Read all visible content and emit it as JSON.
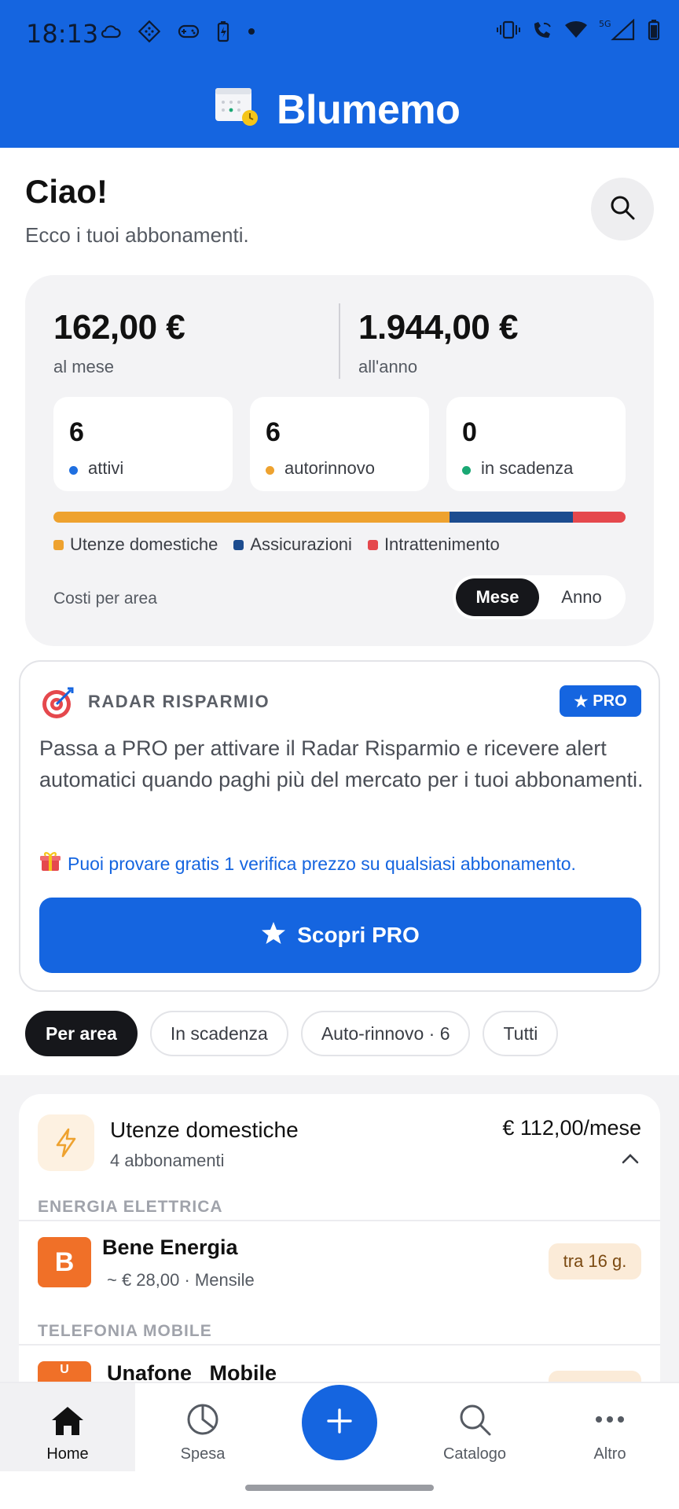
{
  "status": {
    "time": "18:13",
    "network": "5G"
  },
  "app": {
    "title": "Blumemo"
  },
  "greeting": {
    "title": "Ciao!",
    "subtitle": "Ecco i tuoi abbonamenti."
  },
  "summary": {
    "monthly_amount": "162,00 €",
    "monthly_label": "al mese",
    "yearly_amount": "1.944,00 €",
    "yearly_label": "all'anno",
    "stats": [
      {
        "value": "6",
        "label": "attivi",
        "color": "#1f6fe0"
      },
      {
        "value": "6",
        "label": "autorinnovo",
        "color": "#eea22f"
      },
      {
        "value": "0",
        "label": "in scadenza",
        "color": "#1aa874"
      }
    ],
    "breakdown": [
      {
        "label": "Utenze domestiche",
        "share": 0.692,
        "color": "#eea22f"
      },
      {
        "label": "Assicurazioni",
        "share": 0.216,
        "color": "#1c4c8f"
      },
      {
        "label": "Intrattenimento",
        "share": 0.092,
        "color": "#e5484d"
      }
    ],
    "cost_label": "Costi per area",
    "toggle": {
      "selected": "Mese",
      "other": "Anno"
    }
  },
  "radar": {
    "title": "RADAR RISPARMIO",
    "badge": "PRO",
    "description": "Passa a PRO per attivare il Radar Risparmio e ricevere alert automatici quando paghi più del mercato per i tuoi abbonamenti.",
    "gift_text": "Puoi provare gratis 1 verifica prezzo su qualsiasi abbonamento.",
    "cta": "Scopri PRO"
  },
  "filters": [
    "Per area",
    "In scadenza",
    "Auto-rinnovo · 6",
    "Tutti"
  ],
  "group": {
    "title": "Utenze domestiche",
    "count": "4 abbonamenti",
    "amount": "€ 112,00/mese",
    "sections": [
      {
        "header": "ENERGIA ELETTRICA",
        "items": [
          {
            "logo": "B",
            "name": "Bene Energia",
            "meta": "~ € 28,00 · Mensile",
            "due": "tra 16 g."
          }
        ]
      },
      {
        "header": "TELEFONIA MOBILE",
        "items": [
          {
            "logo": "U",
            "name": "Unafone   Mobile"
          }
        ]
      }
    ]
  },
  "nav": {
    "home": "Home",
    "spesa": "Spesa",
    "catalogo": "Catalogo",
    "altro": "Altro"
  },
  "colors": {
    "primary": "#1565e0",
    "dark": "#16171b"
  }
}
